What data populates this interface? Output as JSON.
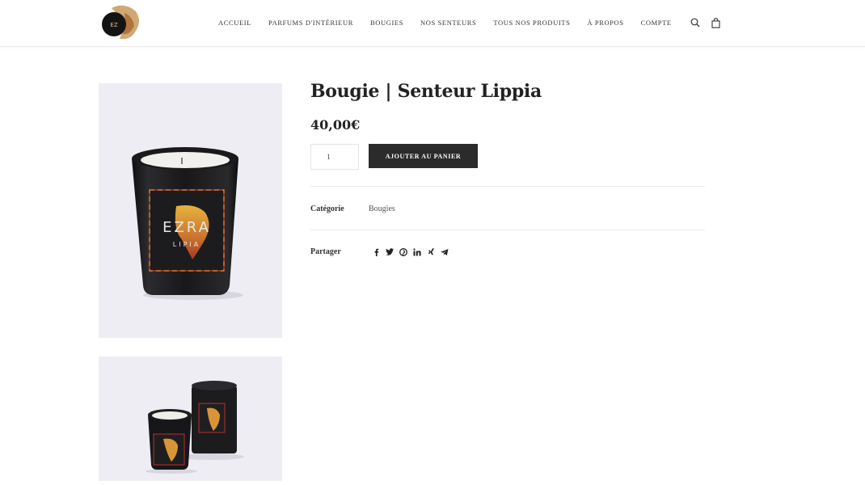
{
  "header": {
    "logo_alt": "EZRA",
    "nav": [
      "ACCUEIL",
      "PARFUMS D'INTÉRIEUR",
      "BOUGIES",
      "NOS SENTEURS",
      "TOUS NOS PRODUITS",
      "À PROPOS",
      "COMPTE"
    ],
    "icons": [
      "search-icon",
      "shopping-bag-icon"
    ]
  },
  "product": {
    "title": "Bougie | Senteur Lippia",
    "price": "40,00€",
    "quantity": "1",
    "add_to_cart_label": "AJOUTER AU PANIER",
    "label_brand": "EZRA",
    "label_scent": "LIPIA",
    "category_label": "Catégorie",
    "category_value": "Bougies",
    "share_label": "Partager",
    "share_icons": [
      "facebook-icon",
      "twitter-icon",
      "pinterest-icon",
      "linkedin-icon",
      "xing-icon",
      "telegram-icon"
    ]
  },
  "colors": {
    "accent_dark": "#2b2b2b",
    "image_bg": "#eeedf4",
    "candle_black": "#1b1b1d"
  }
}
